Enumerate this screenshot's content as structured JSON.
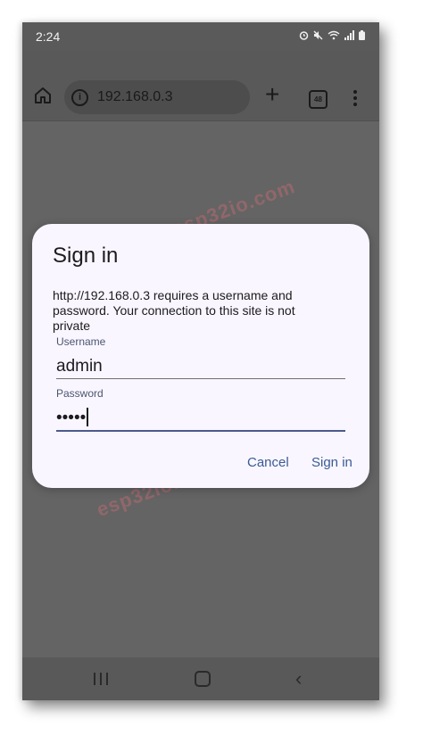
{
  "status_bar": {
    "time": "2:24"
  },
  "browser": {
    "url": "192.168.0.3",
    "tab_count": "48"
  },
  "watermark": "esp32io.com",
  "dialog": {
    "title": "Sign in",
    "message": "http://192.168.0.3 requires a username and password. Your connection to this site is not private",
    "username_label": "Username",
    "username_value": "admin",
    "password_label": "Password",
    "password_value": "•••••",
    "cancel_label": "Cancel",
    "signin_label": "Sign in"
  },
  "icons": [
    "alarm-icon",
    "mute-icon",
    "wifi-icon",
    "signal-icon",
    "battery-icon",
    "home-icon",
    "info-icon",
    "plus-icon",
    "tabs-icon",
    "menu-icon",
    "recent-apps-icon",
    "nav-home-icon",
    "back-icon"
  ]
}
